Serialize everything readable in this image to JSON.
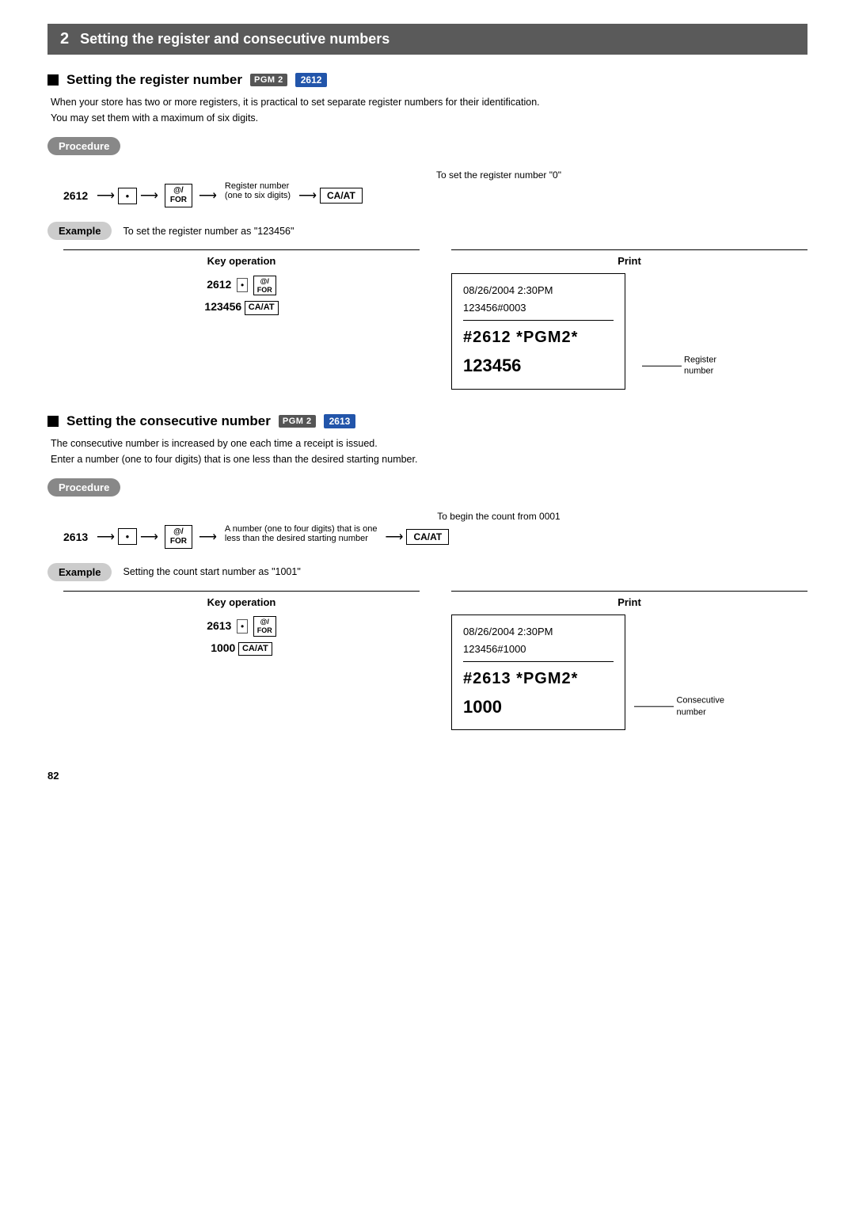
{
  "page": {
    "number": "82",
    "section_number": "2",
    "section_title": "Setting the register and consecutive numbers"
  },
  "register_section": {
    "title": "Setting the register number",
    "badge_pgm": "PGM 2",
    "badge_code": "2612",
    "description": "When your store has two or more registers, it is practical to set separate register numbers for their identification.\nYou may set them with a maximum of six digits.",
    "procedure_label": "Procedure",
    "above_flow_label": "To set the register number \"0\"",
    "flow_code": "2612",
    "key_dot": "•",
    "key_at_for": "@/\nFOR",
    "register_number_label": "Register number",
    "register_number_sub": "(one to six digits)",
    "key_caat": "CA/AT",
    "example_label": "Example",
    "example_text": "To set the register number as \"123456\"",
    "key_op_header": "Key operation",
    "print_header": "Print",
    "key_op_line1": "2612",
    "key_op_dot": "•",
    "key_op_at": "@/\nFOR",
    "key_op_line2": "123456",
    "key_op_caat": "CA/AT",
    "receipt": {
      "line1": "08/26/2004  2:30PM",
      "line2": "123456#0003",
      "line3": "#2612 *PGM2*",
      "line4": "123456",
      "annotation": "Register\nnumber"
    }
  },
  "consecutive_section": {
    "title": "Setting the consecutive number",
    "badge_pgm": "PGM 2",
    "badge_code": "2613",
    "description1": "The consecutive number is increased by one each time a receipt is issued.",
    "description2": "Enter a number (one to four digits) that is one less than the desired starting number.",
    "procedure_label": "Procedure",
    "above_flow_label": "To begin the count from 0001",
    "flow_code": "2613",
    "key_dot": "•",
    "key_at_for": "@/\nFOR",
    "number_label": "A number (one to four digits) that is one",
    "number_sub": "less than the desired starting number",
    "key_caat": "CA/AT",
    "example_label": "Example",
    "example_text": "Setting the count start number as \"1001\"",
    "key_op_header": "Key operation",
    "print_header": "Print",
    "key_op_line1": "2613",
    "key_op_dot": "•",
    "key_op_at": "@/\nFOR",
    "key_op_line2": "1000",
    "key_op_caat": "CA/AT",
    "receipt": {
      "line1": "08/26/2004  2:30PM",
      "line2": "123456#1000",
      "line3": "#2613 *PGM2*",
      "line4": "1000",
      "annotation": "Consecutive\nnumber"
    }
  }
}
